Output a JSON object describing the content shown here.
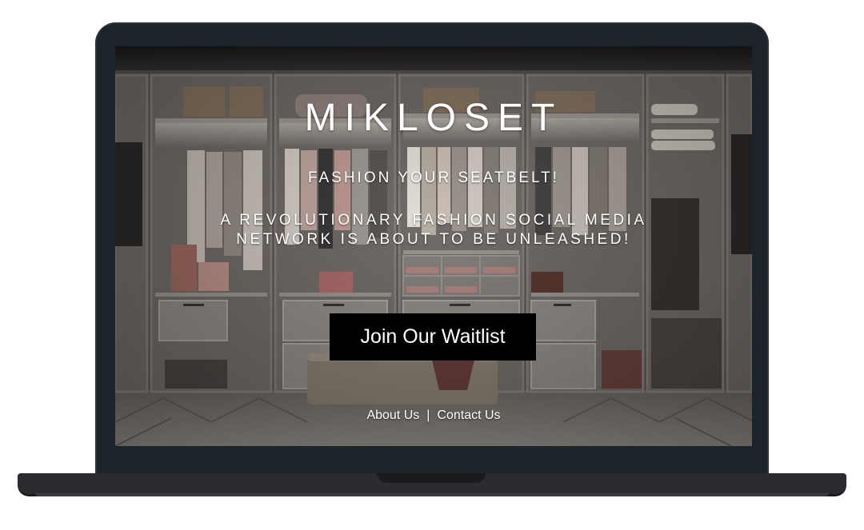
{
  "landing": {
    "brand_name": "MIKLOSET",
    "tagline": "FASHION YOUR SEATBELT!",
    "description": "A REVOLUTIONARY FASHION SOCIAL MEDIA NETWORK IS ABOUT TO BE UNLEASHED!",
    "cta_label": "Join Our Waitlist",
    "footer": {
      "about_label": "About Us",
      "separator": "|",
      "contact_label": "Contact Us"
    }
  },
  "colors": {
    "bezel": "#1b232b",
    "laptop_base": "#2a2c2f",
    "cta_background": "#000000",
    "text": "#ffffff",
    "closet_wood": "#6e6864",
    "floor": "#8d8780"
  },
  "background_image": "walk-in-closet-photo"
}
